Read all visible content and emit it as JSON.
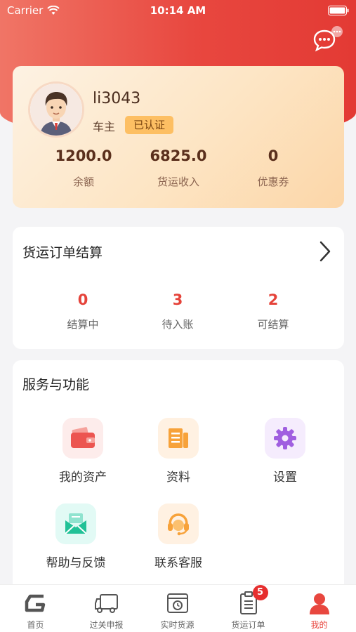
{
  "status_bar": {
    "carrier": "Carrier",
    "time": "10:14 AM"
  },
  "profile": {
    "username": "li3043",
    "role": "车主",
    "verified_label": "已认证",
    "stats": [
      {
        "value": "1200.0",
        "label": "余额"
      },
      {
        "value": "6825.0",
        "label": "货运收入"
      },
      {
        "value": "0",
        "label": "优惠券"
      }
    ]
  },
  "settlement": {
    "title": "货运订单结算",
    "stats": [
      {
        "value": "0",
        "label": "结算中"
      },
      {
        "value": "3",
        "label": "待入账"
      },
      {
        "value": "2",
        "label": "可结算"
      }
    ]
  },
  "services": {
    "title": "服务与功能",
    "items": [
      {
        "label": "我的资产",
        "icon": "wallet-icon"
      },
      {
        "label": "资料",
        "icon": "document-icon"
      },
      {
        "label": "设置",
        "icon": "gear-icon"
      },
      {
        "label": "帮助与反馈",
        "icon": "mail-icon"
      },
      {
        "label": "联系客服",
        "icon": "headset-icon"
      }
    ]
  },
  "tabbar": {
    "items": [
      {
        "label": "首页",
        "icon": "home-logo-icon"
      },
      {
        "label": "过关申报",
        "icon": "truck-icon"
      },
      {
        "label": "实时货源",
        "icon": "clock-box-icon"
      },
      {
        "label": "货运订单",
        "icon": "clipboard-icon",
        "badge": "5"
      },
      {
        "label": "我的",
        "icon": "user-icon",
        "active": true
      }
    ]
  },
  "colors": {
    "accent": "#e8473f",
    "card_gold": "#fde5c4",
    "badge_red": "#e62e2e"
  }
}
